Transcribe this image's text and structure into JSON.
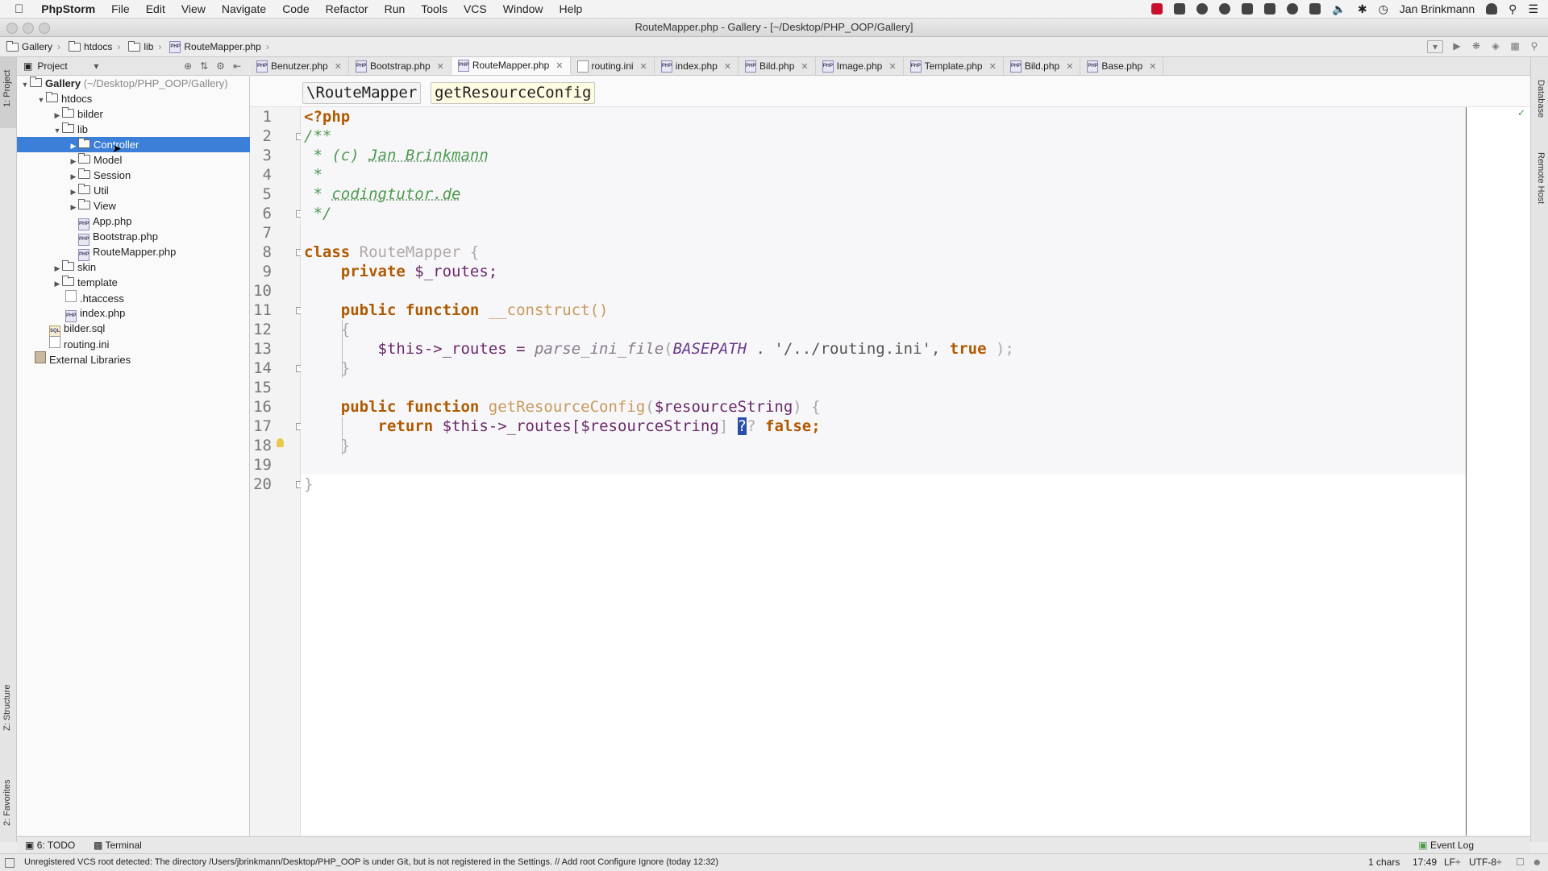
{
  "menubar": {
    "app": "PhpStorm",
    "items": [
      "File",
      "Edit",
      "View",
      "Navigate",
      "Code",
      "Refactor",
      "Run",
      "Tools",
      "VCS",
      "Window",
      "Help"
    ],
    "user": "Jan Brinkmann"
  },
  "window": {
    "title": "RouteMapper.php - Gallery - [~/Desktop/PHP_OOP/Gallery]"
  },
  "navbar": {
    "crumbs": [
      "Gallery",
      "htdocs",
      "lib",
      "RouteMapper.php"
    ]
  },
  "project": {
    "header": "Project",
    "tree": [
      {
        "label": "Gallery",
        "suffix": "(~/Desktop/PHP_OOP/Gallery)"
      },
      {
        "label": "htdocs"
      },
      {
        "label": "bilder"
      },
      {
        "label": "lib"
      },
      {
        "label": "Controller"
      },
      {
        "label": "Model"
      },
      {
        "label": "Session"
      },
      {
        "label": "Util"
      },
      {
        "label": "View"
      },
      {
        "label": "App.php"
      },
      {
        "label": "Bootstrap.php"
      },
      {
        "label": "RouteMapper.php"
      },
      {
        "label": "skin"
      },
      {
        "label": "template"
      },
      {
        "label": ".htaccess"
      },
      {
        "label": "index.php"
      },
      {
        "label": "bilder.sql"
      },
      {
        "label": "routing.ini"
      },
      {
        "label": "External Libraries"
      }
    ]
  },
  "tabs": [
    "Benutzer.php",
    "Bootstrap.php",
    "RouteMapper.php",
    "routing.ini",
    "index.php",
    "Bild.php",
    "Image.php",
    "Template.php",
    "Bild.php",
    "Base.php"
  ],
  "editor_crumbs": [
    "\\RouteMapper",
    "getResourceConfig"
  ],
  "line_numbers": [
    "1",
    "2",
    "3",
    "4",
    "5",
    "6",
    "7",
    "8",
    "9",
    "10",
    "11",
    "12",
    "13",
    "14",
    "15",
    "16",
    "17",
    "18",
    "19",
    "20"
  ],
  "code": {
    "l1": "<?php",
    "l2": "/**",
    "l3a": " * (c) ",
    "l3b": "Jan Brinkmann",
    "l4": " *",
    "l5a": " * ",
    "l5b": "codingtutor.de",
    "l6": " */",
    "l8a": "class ",
    "l8b": "RouteMapper {",
    "l9a": "    private ",
    "l9b": "$_routes;",
    "l11a": "    public function ",
    "l11b": "__construct()",
    "l12": "    {",
    "l13a": "        $this->_routes = ",
    "l13b": "parse_ini_file",
    "l13c": "(",
    "l13d": "BASEPATH",
    "l13e": " . '/../routing.ini', ",
    "l13f": "true",
    "l13g": " );",
    "l14": "    }",
    "l16a": "    public function ",
    "l16b": "getResourceConfig",
    "l16c": "(",
    "l16d": "$resourceString",
    "l16e": ") {",
    "l17a": "        return ",
    "l17b": "$this->_routes[",
    "l17c": "$resourceString",
    "l17d": "] ",
    "l17e": "?",
    "l17f": "? ",
    "l17g": "false;",
    "l18": "    }",
    "l20": "}"
  },
  "right_strip": [
    "Database",
    "Remote Host"
  ],
  "left_strip": [
    "1: Project",
    "Z: Structure",
    "2: Favorites"
  ],
  "bottom_tools": {
    "todo": "6: TODO",
    "terminal": "Terminal",
    "event_log": "Event Log"
  },
  "status": {
    "message": "Unregistered VCS root detected: The directory /Users/jbrinkmann/Desktop/PHP_OOP is under Git, but is not registered in the Settings. // Add root  Configure  Ignore (today 12:32)",
    "chars": "1 chars",
    "position": "17:49",
    "line_sep": "LF÷",
    "encoding": "UTF-8÷"
  }
}
